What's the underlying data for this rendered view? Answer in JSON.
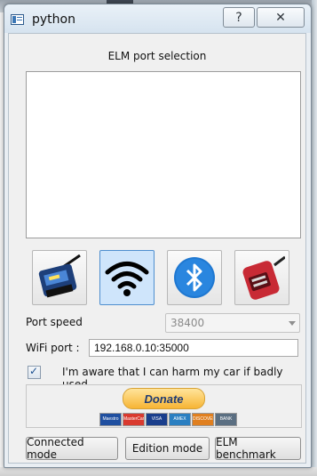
{
  "window": {
    "title": "python",
    "help_label": "?",
    "close_label": "✕"
  },
  "port_selection": {
    "label": "ELM port selection"
  },
  "connection_modes": [
    {
      "name": "usb",
      "icon": "elm-usb-adapter-icon"
    },
    {
      "name": "wifi",
      "icon": "wifi-icon",
      "selected": true
    },
    {
      "name": "bluetooth",
      "icon": "bluetooth-icon"
    },
    {
      "name": "obd",
      "icon": "obd-cable-icon"
    }
  ],
  "port_speed": {
    "label": "Port speed",
    "value": "38400"
  },
  "wifi_port": {
    "label": "WiFi port :",
    "value": "192.168.0.10:35000"
  },
  "awareness": {
    "checked": true,
    "check_mark": "✓",
    "label": "I'm aware that I can harm my car if badly used"
  },
  "donate": {
    "button_label": "Donate",
    "cards": [
      {
        "label": "Maestro",
        "color": "#1f4fa0"
      },
      {
        "label": "MasterCard",
        "color": "#d93a2f"
      },
      {
        "label": "VISA",
        "color": "#1a3e8c"
      },
      {
        "label": "AMEX",
        "color": "#2a7fc1"
      },
      {
        "label": "DISCOVER",
        "color": "#e07f1f"
      },
      {
        "label": "BANK",
        "color": "#5b6f82"
      }
    ]
  },
  "buttons": {
    "connected": "Connected mode",
    "edition": "Edition mode",
    "benchmark": "ELM benchmark"
  }
}
